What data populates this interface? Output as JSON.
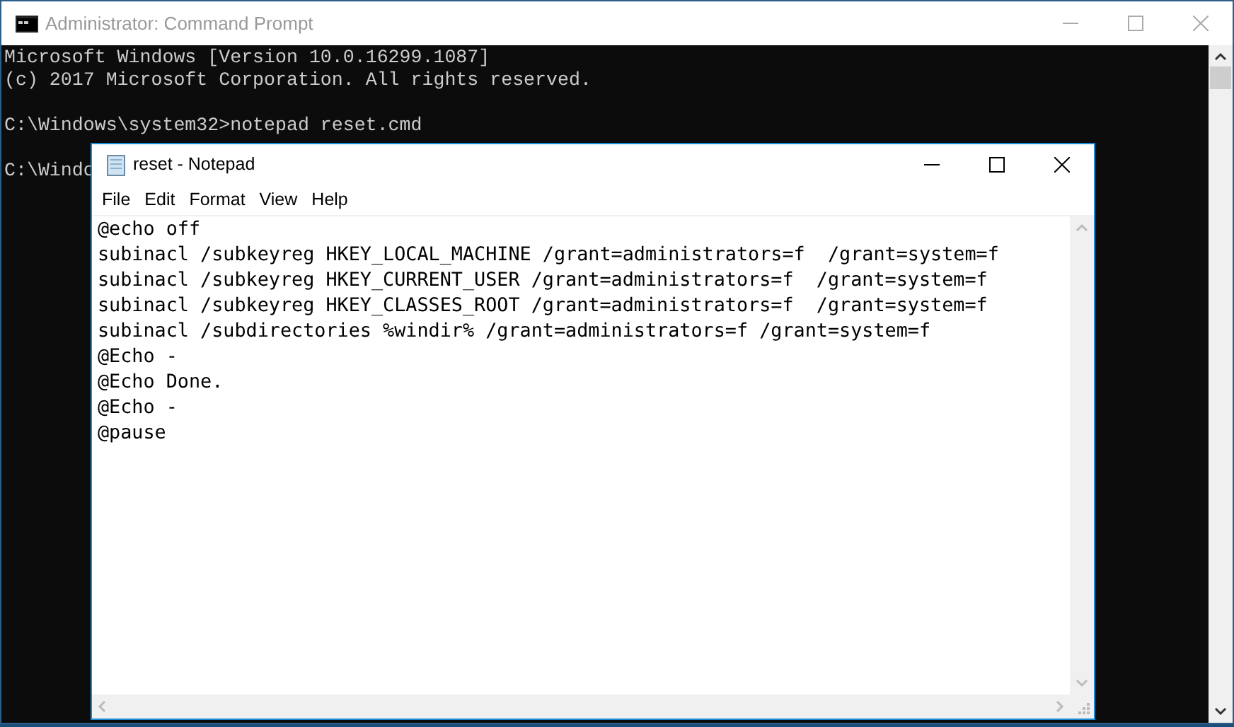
{
  "console_window": {
    "title": "Administrator: Command Prompt",
    "blocks": [
      [
        "Microsoft Windows [Version 10.0.16299.1087]",
        "(c) 2017 Microsoft Corporation. All rights reserved."
      ],
      [
        "C:\\Windows\\system32>notepad reset.cmd"
      ],
      [
        "C:\\Windo"
      ]
    ]
  },
  "notepad_window": {
    "title": "reset - Notepad",
    "menu": [
      "File",
      "Edit",
      "Format",
      "View",
      "Help"
    ],
    "lines": [
      "@echo off",
      "subinacl /subkeyreg HKEY_LOCAL_MACHINE /grant=administrators=f  /grant=system=f",
      "subinacl /subkeyreg HKEY_CURRENT_USER /grant=administrators=f  /grant=system=f",
      "subinacl /subkeyreg HKEY_CLASSES_ROOT /grant=administrators=f  /grant=system=f",
      "subinacl /subdirectories %windir% /grant=administrators=f /grant=system=f",
      "@Echo -",
      "@Echo Done.",
      "@Echo -",
      "@pause"
    ]
  }
}
